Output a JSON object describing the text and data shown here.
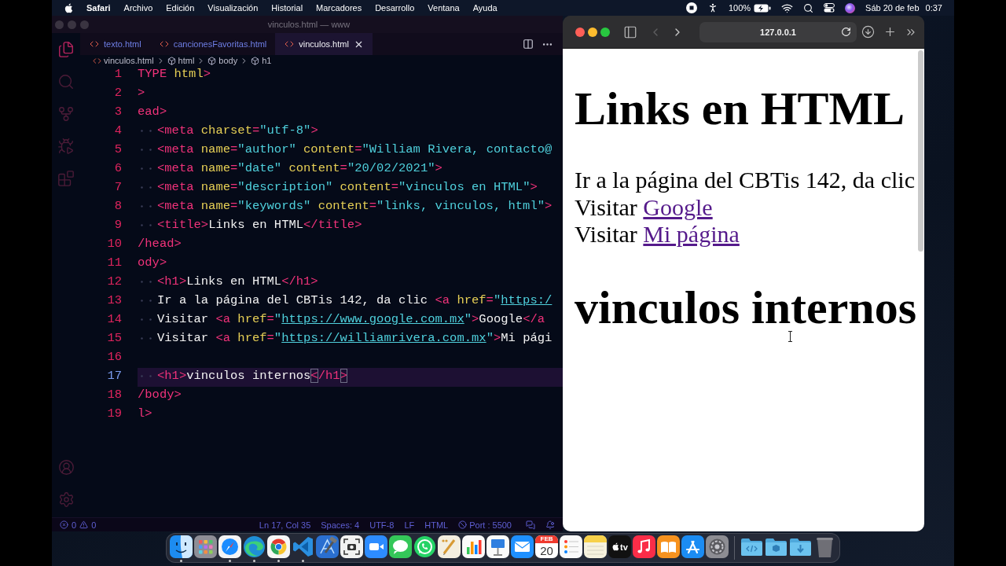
{
  "menu_bar": {
    "app": "Safari",
    "items": [
      "Archivo",
      "Edición",
      "Visualización",
      "Historial",
      "Marcadores",
      "Desarrollo",
      "Ventana",
      "Ayuda"
    ],
    "battery": "100%",
    "date": "Sáb 20 de feb",
    "time": "0:37"
  },
  "editor": {
    "window": {
      "title": "vinculos.html — www",
      "active": false
    },
    "activity_bar": [
      {
        "kind": "files",
        "selected": true
      },
      {
        "kind": "search",
        "selected": false
      },
      {
        "kind": "source_control",
        "selected": false
      },
      {
        "kind": "run",
        "selected": false
      },
      {
        "kind": "extensions",
        "selected": false
      }
    ],
    "activity_bar_bottom": [
      {
        "kind": "account"
      },
      {
        "kind": "settings"
      }
    ],
    "tabs": [
      {
        "label": "texto.html",
        "selected": false
      },
      {
        "label": "cancionesFavoritas.html",
        "selected": false
      },
      {
        "label": "vinculos.html",
        "selected": true
      }
    ],
    "breadcrumb": [
      {
        "kind": "file",
        "label": "vinculos.html"
      },
      {
        "kind": "element",
        "label": "html"
      },
      {
        "kind": "element",
        "label": "body"
      },
      {
        "kind": "element",
        "label": "h1"
      }
    ],
    "lines": [
      {
        "number": "1",
        "current": false,
        "indented": false,
        "tokens": [
          {
            "kind": "tag",
            "text": "TYPE"
          },
          {
            "kind": "attr",
            "text": " html"
          },
          {
            "kind": "tag",
            "text": ">"
          }
        ]
      },
      {
        "number": "2",
        "current": false,
        "indented": false,
        "tokens": [
          {
            "kind": "tag",
            "text": ">"
          }
        ]
      },
      {
        "number": "3",
        "current": false,
        "indented": false,
        "tokens": [
          {
            "kind": "tag",
            "text": "ead>"
          }
        ]
      },
      {
        "number": "4",
        "current": false,
        "indented": true,
        "tokens": [
          {
            "kind": "tag",
            "text": "<meta"
          },
          {
            "kind": "attr",
            "text": " charset"
          },
          {
            "kind": "tag",
            "text": "="
          },
          {
            "kind": "str",
            "text": "\"utf-8\""
          },
          {
            "kind": "tag",
            "text": ">"
          }
        ]
      },
      {
        "number": "5",
        "current": false,
        "indented": true,
        "tokens": [
          {
            "kind": "tag",
            "text": "<meta"
          },
          {
            "kind": "attr",
            "text": " name"
          },
          {
            "kind": "tag",
            "text": "="
          },
          {
            "kind": "str",
            "text": "\"author\""
          },
          {
            "kind": "attr",
            "text": " content"
          },
          {
            "kind": "tag",
            "text": "="
          },
          {
            "kind": "str",
            "text": "\"William Rivera, contacto@"
          }
        ]
      },
      {
        "number": "6",
        "current": false,
        "indented": true,
        "tokens": [
          {
            "kind": "tag",
            "text": "<meta"
          },
          {
            "kind": "attr",
            "text": " name"
          },
          {
            "kind": "tag",
            "text": "="
          },
          {
            "kind": "str",
            "text": "\"date\""
          },
          {
            "kind": "attr",
            "text": " content"
          },
          {
            "kind": "tag",
            "text": "="
          },
          {
            "kind": "str",
            "text": "\"20/02/2021\""
          },
          {
            "kind": "tag",
            "text": ">"
          }
        ]
      },
      {
        "number": "7",
        "current": false,
        "indented": true,
        "tokens": [
          {
            "kind": "tag",
            "text": "<meta"
          },
          {
            "kind": "attr",
            "text": " name"
          },
          {
            "kind": "tag",
            "text": "="
          },
          {
            "kind": "str",
            "text": "\"description\""
          },
          {
            "kind": "attr",
            "text": " content"
          },
          {
            "kind": "tag",
            "text": "="
          },
          {
            "kind": "str",
            "text": "\"vinculos en HTML\""
          },
          {
            "kind": "tag",
            "text": ">"
          }
        ]
      },
      {
        "number": "8",
        "current": false,
        "indented": true,
        "tokens": [
          {
            "kind": "tag",
            "text": "<meta"
          },
          {
            "kind": "attr",
            "text": " name"
          },
          {
            "kind": "tag",
            "text": "="
          },
          {
            "kind": "str",
            "text": "\"keywords\""
          },
          {
            "kind": "attr",
            "text": " content"
          },
          {
            "kind": "tag",
            "text": "="
          },
          {
            "kind": "str",
            "text": "\"links, vinculos, html\""
          },
          {
            "kind": "tag",
            "text": ">"
          }
        ]
      },
      {
        "number": "9",
        "current": false,
        "indented": true,
        "tokens": [
          {
            "kind": "tag",
            "text": "<title>"
          },
          {
            "kind": "text",
            "text": "Links en HTML"
          },
          {
            "kind": "tag",
            "text": "</title>"
          }
        ]
      },
      {
        "number": "10",
        "current": false,
        "indented": false,
        "tokens": [
          {
            "kind": "tag",
            "text": "/head>"
          }
        ]
      },
      {
        "number": "11",
        "current": false,
        "indented": false,
        "tokens": [
          {
            "kind": "tag",
            "text": "ody>"
          }
        ]
      },
      {
        "number": "12",
        "current": false,
        "indented": true,
        "tokens": [
          {
            "kind": "tag",
            "text": "<h1>"
          },
          {
            "kind": "text",
            "text": "Links en HTML"
          },
          {
            "kind": "tag",
            "text": "</h1>"
          }
        ]
      },
      {
        "number": "13",
        "current": false,
        "indented": true,
        "tokens": [
          {
            "kind": "text",
            "text": "Ir a la página del CBTis 142, da clic "
          },
          {
            "kind": "tag",
            "text": "<a"
          },
          {
            "kind": "attr",
            "text": " href"
          },
          {
            "kind": "tag",
            "text": "="
          },
          {
            "kind": "str",
            "text": "\""
          },
          {
            "kind": "link",
            "text": "https:/"
          }
        ]
      },
      {
        "number": "14",
        "current": false,
        "indented": true,
        "tokens": [
          {
            "kind": "text",
            "text": "Visitar "
          },
          {
            "kind": "tag",
            "text": "<a"
          },
          {
            "kind": "attr",
            "text": " href"
          },
          {
            "kind": "tag",
            "text": "="
          },
          {
            "kind": "str",
            "text": "\""
          },
          {
            "kind": "link",
            "text": "https://www.google.com.mx"
          },
          {
            "kind": "str",
            "text": "\""
          },
          {
            "kind": "tag",
            "text": ">"
          },
          {
            "kind": "text",
            "text": "Google"
          },
          {
            "kind": "tag",
            "text": "</a"
          }
        ]
      },
      {
        "number": "15",
        "current": false,
        "indented": true,
        "tokens": [
          {
            "kind": "text",
            "text": "Visitar "
          },
          {
            "kind": "tag",
            "text": "<a"
          },
          {
            "kind": "attr",
            "text": " href"
          },
          {
            "kind": "tag",
            "text": "="
          },
          {
            "kind": "str",
            "text": "\""
          },
          {
            "kind": "link",
            "text": "https://williamrivera.com.mx"
          },
          {
            "kind": "str",
            "text": "\""
          },
          {
            "kind": "tag",
            "text": ">"
          },
          {
            "kind": "text",
            "text": "Mi pági"
          }
        ]
      },
      {
        "number": "16",
        "current": false,
        "indented": false
      },
      {
        "number": "17",
        "current": true,
        "indented": true,
        "tokens": [
          {
            "kind": "tag",
            "text": "<h1>"
          },
          {
            "kind": "text",
            "text": "vinculos internos"
          },
          {
            "kind": "bracket",
            "text": "<"
          },
          {
            "kind": "tag",
            "text": "/h1"
          },
          {
            "kind": "bracket",
            "text": ">"
          }
        ]
      },
      {
        "number": "18",
        "current": false,
        "indented": false,
        "tokens": [
          {
            "kind": "tag",
            "text": "/body>"
          }
        ]
      },
      {
        "number": "19",
        "current": false,
        "indented": false,
        "tokens": [
          {
            "kind": "tag",
            "text": "l>"
          }
        ]
      }
    ],
    "status_bar": {
      "errors": "0",
      "warnings": "0",
      "items": [
        "Ln 17, Col 35",
        "Spaces: 4",
        "UTF-8",
        "LF",
        "HTML"
      ],
      "port": "Port : 5500"
    }
  },
  "browser": {
    "window": {
      "active": true
    },
    "back_disabled": true,
    "forward_disabled": false,
    "address": "127.0.0.1",
    "content": [
      {
        "kind": "h1",
        "text": "Links en HTML"
      },
      {
        "kind": "p",
        "text": "Ir a la página del CBTis 142, da clic"
      },
      {
        "kind": "p",
        "text": "Visitar",
        "link": "Google"
      },
      {
        "kind": "p",
        "text": "Visitar",
        "link": "Mi página"
      },
      {
        "kind": "h1",
        "text": "vinculos internos"
      }
    ]
  },
  "dock": {
    "apps": [
      {
        "kind": "finder",
        "running": true
      },
      {
        "kind": "launchpad",
        "running": false
      },
      {
        "kind": "safari",
        "running": true
      },
      {
        "kind": "edge",
        "running": true
      },
      {
        "kind": "chrome",
        "running": true
      },
      {
        "kind": "vscode",
        "running": true
      },
      {
        "kind": "xcode",
        "running": false
      },
      {
        "kind": "screenshot",
        "running": false
      },
      {
        "kind": "zoom",
        "running": false
      },
      {
        "kind": "messages",
        "running": false
      },
      {
        "kind": "whatsapp",
        "running": false
      },
      {
        "kind": "pages",
        "running": false
      },
      {
        "kind": "numbers",
        "running": false
      },
      {
        "kind": "keynote",
        "running": false
      },
      {
        "kind": "mail",
        "running": false
      },
      {
        "kind": "calendar",
        "running": false,
        "month": "FEB",
        "day": "20"
      },
      {
        "kind": "reminders",
        "running": false
      },
      {
        "kind": "notes",
        "running": false
      },
      {
        "kind": "tv",
        "running": false,
        "label": "tv"
      },
      {
        "kind": "music",
        "running": false
      },
      {
        "kind": "books",
        "running": false
      },
      {
        "kind": "appstore",
        "running": false
      },
      {
        "kind": "settings",
        "running": false
      }
    ],
    "folders": [
      {
        "kind": "code"
      },
      {
        "kind": "package"
      },
      {
        "kind": "downloads"
      }
    ]
  }
}
